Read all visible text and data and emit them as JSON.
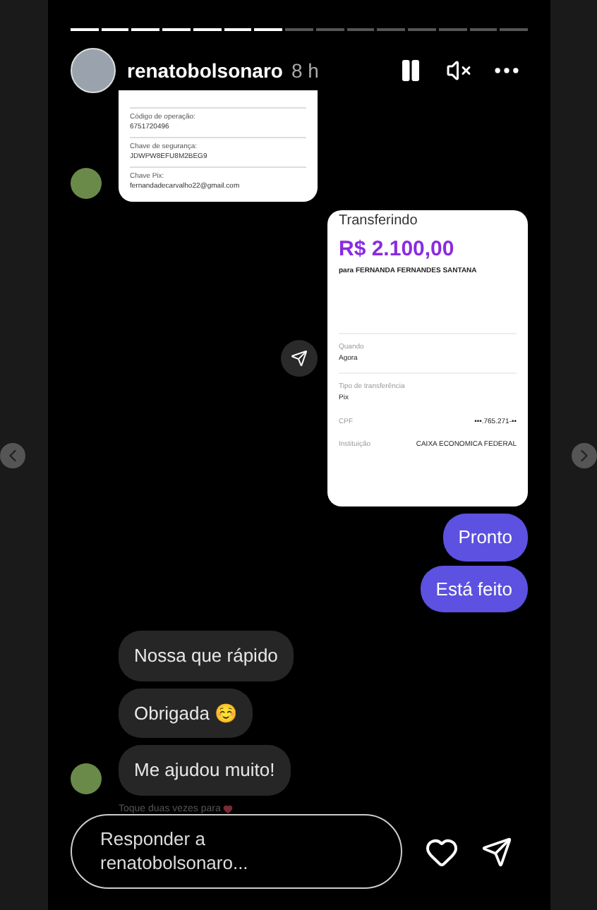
{
  "progress": [
    {
      "seen": true
    },
    {
      "seen": true
    },
    {
      "seen": true
    },
    {
      "seen": true
    },
    {
      "seen": true
    },
    {
      "seen": true
    },
    {
      "seen": true
    },
    {
      "seen": false
    },
    {
      "seen": false
    },
    {
      "seen": false
    },
    {
      "seen": false
    },
    {
      "seen": false
    },
    {
      "seen": false
    },
    {
      "seen": false
    },
    {
      "seen": false
    }
  ],
  "header": {
    "username": "renatobolsonaro",
    "time": "8 h"
  },
  "receipt_snippet": [
    {
      "label": "Código de operação:",
      "value": "6751720496"
    },
    {
      "label": "Chave de segurança:",
      "value": "JDWPW8EFU8M2BEG9"
    },
    {
      "label": "Chave Pix:",
      "value": "fernandadecarvalho22@gmail.com"
    }
  ],
  "transfer": {
    "title": "Transferindo",
    "amount": "R$ 2.100,00",
    "recipient": "para FERNANDA FERNANDES SANTANA",
    "fields": [
      {
        "kind": "stacked",
        "label": "Quando",
        "value": "Agora"
      },
      {
        "kind": "stacked",
        "label": "Tipo de transferência",
        "value": "Pix"
      },
      {
        "kind": "inline",
        "label": "CPF",
        "value": "•••.765.271-••"
      },
      {
        "kind": "inline",
        "label": "Instituição",
        "value": "CAIXA ECONOMICA FEDERAL"
      }
    ]
  },
  "messages": [
    {
      "kind": "sent",
      "text": "Pronto"
    },
    {
      "kind": "sent",
      "text": "Está feito"
    },
    {
      "kind": "received",
      "text": "Nossa que rápido"
    },
    {
      "kind": "received",
      "text": "Obrigada ☺️"
    },
    {
      "kind": "received",
      "text": "Me ajudou muito!"
    }
  ],
  "hint": "Toque duas vezes para",
  "reply": {
    "placeholder": "Responder a renatobolsonaro..."
  }
}
